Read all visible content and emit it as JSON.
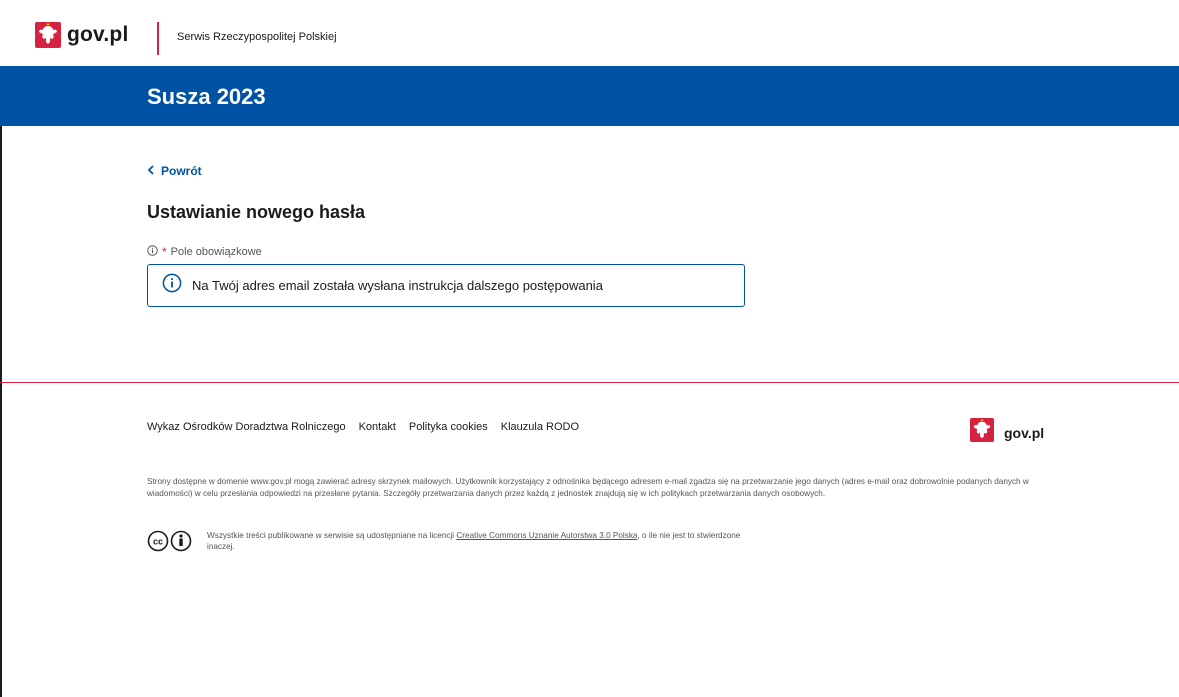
{
  "header": {
    "logo_text": "gov.pl",
    "service_name": "Serwis Rzeczypospolitej Polskiej"
  },
  "banner": {
    "title": "Susza 2023"
  },
  "main": {
    "back_label": "Powrót",
    "title": "Ustawianie nowego hasła",
    "required_label": "Pole obowiązkowe",
    "info_message": "Na Twój adres email została wysłana instrukcja dalszego postępowania"
  },
  "footer": {
    "links": [
      "Wykaz Ośrodków Doradztwa Rolniczego",
      "Kontakt",
      "Polityka cookies",
      "Klauzula RODO"
    ],
    "logo_text": "gov.pl",
    "note": "Strony dostępne w domenie www.gov.pl mogą zawierać adresy skrzynek mailowych. Użytkownik korzystający z odnośnika będącego adresem e-mail zgadza się na przetwarzanie jego danych (adres e-mail oraz dobrowolnie podanych danych w wiadomości) w celu przesłania odpowiedzi na przesłane pytania. Szczegóły przetwarzania danych przez każdą z jednostek znajdują się w ich politykach przetwarzania danych osobowych.",
    "license_prefix": "Wszystkie treści publikowane w serwisie są udostępniane na licencji ",
    "license_link": "Creative Commons Uznanie Autorstwa 3.0 Polska",
    "license_suffix": ", o ile nie jest to stwierdzone inaczej."
  },
  "colors": {
    "brand_blue": "#0052a5",
    "brand_red": "#d5233f"
  },
  "icons": [
    "emblem-icon",
    "chevron-left-icon",
    "info-icon",
    "info-circle-icon",
    "cc-icon",
    "attribution-icon"
  ]
}
